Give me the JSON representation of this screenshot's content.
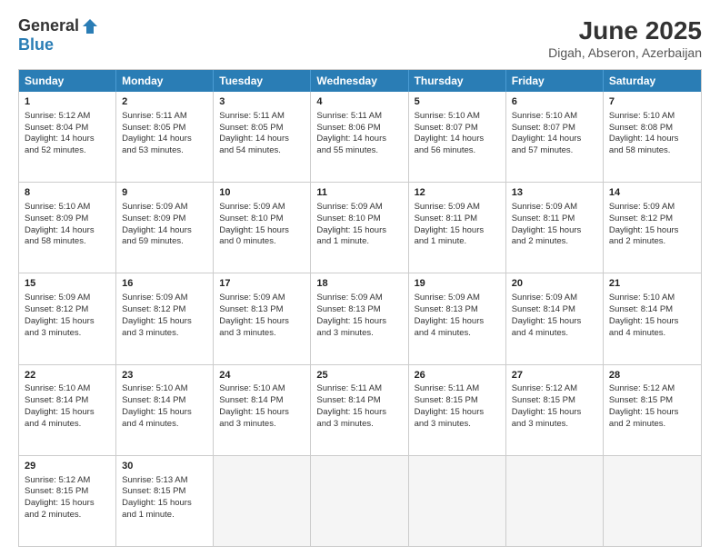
{
  "logo": {
    "general": "General",
    "blue": "Blue"
  },
  "title": "June 2025",
  "location": "Digah, Abseron, Azerbaijan",
  "days_of_week": [
    "Sunday",
    "Monday",
    "Tuesday",
    "Wednesday",
    "Thursday",
    "Friday",
    "Saturday"
  ],
  "weeks": [
    [
      {
        "day": "1",
        "info": "Sunrise: 5:12 AM\nSunset: 8:04 PM\nDaylight: 14 hours\nand 52 minutes."
      },
      {
        "day": "2",
        "info": "Sunrise: 5:11 AM\nSunset: 8:05 PM\nDaylight: 14 hours\nand 53 minutes."
      },
      {
        "day": "3",
        "info": "Sunrise: 5:11 AM\nSunset: 8:05 PM\nDaylight: 14 hours\nand 54 minutes."
      },
      {
        "day": "4",
        "info": "Sunrise: 5:11 AM\nSunset: 8:06 PM\nDaylight: 14 hours\nand 55 minutes."
      },
      {
        "day": "5",
        "info": "Sunrise: 5:10 AM\nSunset: 8:07 PM\nDaylight: 14 hours\nand 56 minutes."
      },
      {
        "day": "6",
        "info": "Sunrise: 5:10 AM\nSunset: 8:07 PM\nDaylight: 14 hours\nand 57 minutes."
      },
      {
        "day": "7",
        "info": "Sunrise: 5:10 AM\nSunset: 8:08 PM\nDaylight: 14 hours\nand 58 minutes."
      }
    ],
    [
      {
        "day": "8",
        "info": "Sunrise: 5:10 AM\nSunset: 8:09 PM\nDaylight: 14 hours\nand 58 minutes."
      },
      {
        "day": "9",
        "info": "Sunrise: 5:09 AM\nSunset: 8:09 PM\nDaylight: 14 hours\nand 59 minutes."
      },
      {
        "day": "10",
        "info": "Sunrise: 5:09 AM\nSunset: 8:10 PM\nDaylight: 15 hours\nand 0 minutes."
      },
      {
        "day": "11",
        "info": "Sunrise: 5:09 AM\nSunset: 8:10 PM\nDaylight: 15 hours\nand 1 minute."
      },
      {
        "day": "12",
        "info": "Sunrise: 5:09 AM\nSunset: 8:11 PM\nDaylight: 15 hours\nand 1 minute."
      },
      {
        "day": "13",
        "info": "Sunrise: 5:09 AM\nSunset: 8:11 PM\nDaylight: 15 hours\nand 2 minutes."
      },
      {
        "day": "14",
        "info": "Sunrise: 5:09 AM\nSunset: 8:12 PM\nDaylight: 15 hours\nand 2 minutes."
      }
    ],
    [
      {
        "day": "15",
        "info": "Sunrise: 5:09 AM\nSunset: 8:12 PM\nDaylight: 15 hours\nand 3 minutes."
      },
      {
        "day": "16",
        "info": "Sunrise: 5:09 AM\nSunset: 8:12 PM\nDaylight: 15 hours\nand 3 minutes."
      },
      {
        "day": "17",
        "info": "Sunrise: 5:09 AM\nSunset: 8:13 PM\nDaylight: 15 hours\nand 3 minutes."
      },
      {
        "day": "18",
        "info": "Sunrise: 5:09 AM\nSunset: 8:13 PM\nDaylight: 15 hours\nand 3 minutes."
      },
      {
        "day": "19",
        "info": "Sunrise: 5:09 AM\nSunset: 8:13 PM\nDaylight: 15 hours\nand 4 minutes."
      },
      {
        "day": "20",
        "info": "Sunrise: 5:09 AM\nSunset: 8:14 PM\nDaylight: 15 hours\nand 4 minutes."
      },
      {
        "day": "21",
        "info": "Sunrise: 5:10 AM\nSunset: 8:14 PM\nDaylight: 15 hours\nand 4 minutes."
      }
    ],
    [
      {
        "day": "22",
        "info": "Sunrise: 5:10 AM\nSunset: 8:14 PM\nDaylight: 15 hours\nand 4 minutes."
      },
      {
        "day": "23",
        "info": "Sunrise: 5:10 AM\nSunset: 8:14 PM\nDaylight: 15 hours\nand 4 minutes."
      },
      {
        "day": "24",
        "info": "Sunrise: 5:10 AM\nSunset: 8:14 PM\nDaylight: 15 hours\nand 3 minutes."
      },
      {
        "day": "25",
        "info": "Sunrise: 5:11 AM\nSunset: 8:14 PM\nDaylight: 15 hours\nand 3 minutes."
      },
      {
        "day": "26",
        "info": "Sunrise: 5:11 AM\nSunset: 8:15 PM\nDaylight: 15 hours\nand 3 minutes."
      },
      {
        "day": "27",
        "info": "Sunrise: 5:12 AM\nSunset: 8:15 PM\nDaylight: 15 hours\nand 3 minutes."
      },
      {
        "day": "28",
        "info": "Sunrise: 5:12 AM\nSunset: 8:15 PM\nDaylight: 15 hours\nand 2 minutes."
      }
    ],
    [
      {
        "day": "29",
        "info": "Sunrise: 5:12 AM\nSunset: 8:15 PM\nDaylight: 15 hours\nand 2 minutes."
      },
      {
        "day": "30",
        "info": "Sunrise: 5:13 AM\nSunset: 8:15 PM\nDaylight: 15 hours\nand 1 minute."
      },
      {
        "day": "",
        "info": ""
      },
      {
        "day": "",
        "info": ""
      },
      {
        "day": "",
        "info": ""
      },
      {
        "day": "",
        "info": ""
      },
      {
        "day": "",
        "info": ""
      }
    ]
  ]
}
